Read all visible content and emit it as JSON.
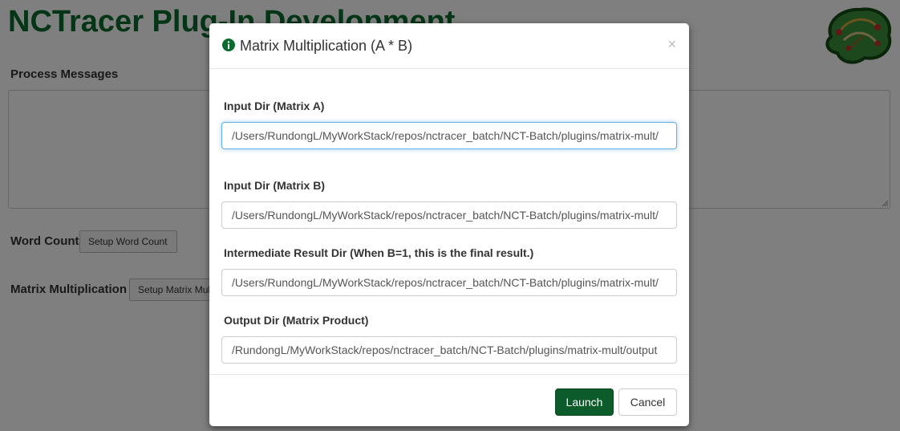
{
  "page": {
    "title": "NCTracer Plug-In Development",
    "process_messages_label": "Process Messages",
    "word_count_label": "Word Count",
    "word_count_button": "Setup Word Count",
    "matrix_label": "Matrix Multiplication",
    "matrix_button": "Setup Matrix Multiplication"
  },
  "modal": {
    "title": "Matrix Multiplication (A * B)",
    "close": "×",
    "fields": [
      {
        "label": "Input Dir (Matrix A)",
        "value": "/Users/RundongL/MyWorkStack/repos/nctracer_batch/NCT-Batch/plugins/matrix-mult/"
      },
      {
        "label": "Input Dir (Matrix B)",
        "value": "/Users/RundongL/MyWorkStack/repos/nctracer_batch/NCT-Batch/plugins/matrix-mult/"
      },
      {
        "label": "Intermediate Result Dir (When B=1, this is the final result.)",
        "value": "/Users/RundongL/MyWorkStack/repos/nctracer_batch/NCT-Batch/plugins/matrix-mult/"
      },
      {
        "label": "Output Dir (Matrix Product)",
        "value": "/RundongL/MyWorkStack/repos/nctracer_batch/NCT-Batch/plugins/matrix-mult/output"
      }
    ],
    "launch": "Launch",
    "cancel": "Cancel"
  },
  "colors": {
    "title_green": "#0b6b2e",
    "launch_green": "#0b5b2b",
    "focus_blue": "#66afe9"
  },
  "icons": [
    "info-icon",
    "close-icon",
    "brain-logo",
    "resize-handle-icon"
  ]
}
